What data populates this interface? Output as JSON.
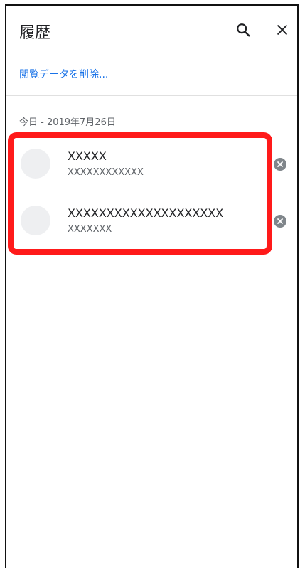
{
  "header": {
    "title": "履歴",
    "search_icon": "search-icon",
    "close_icon": "close-icon"
  },
  "clear_browsing_data_label": "閲覧データを削除...",
  "section": {
    "date_label": "今日 - 2019年7月26日"
  },
  "history": {
    "items": [
      {
        "title": "XXXXX",
        "url": "XXXXXXXXXXXX",
        "remove_icon": "remove-circle-icon"
      },
      {
        "title": "XXXXXXXXXXXXXXXXXXXX",
        "url": "XXXXXXX",
        "remove_icon": "remove-circle-icon"
      }
    ]
  },
  "colors": {
    "accent": "#1a73e8",
    "highlight": "#ff1a1a",
    "secondary_text": "#5f6368",
    "favicon_placeholder": "#eeeff1"
  }
}
